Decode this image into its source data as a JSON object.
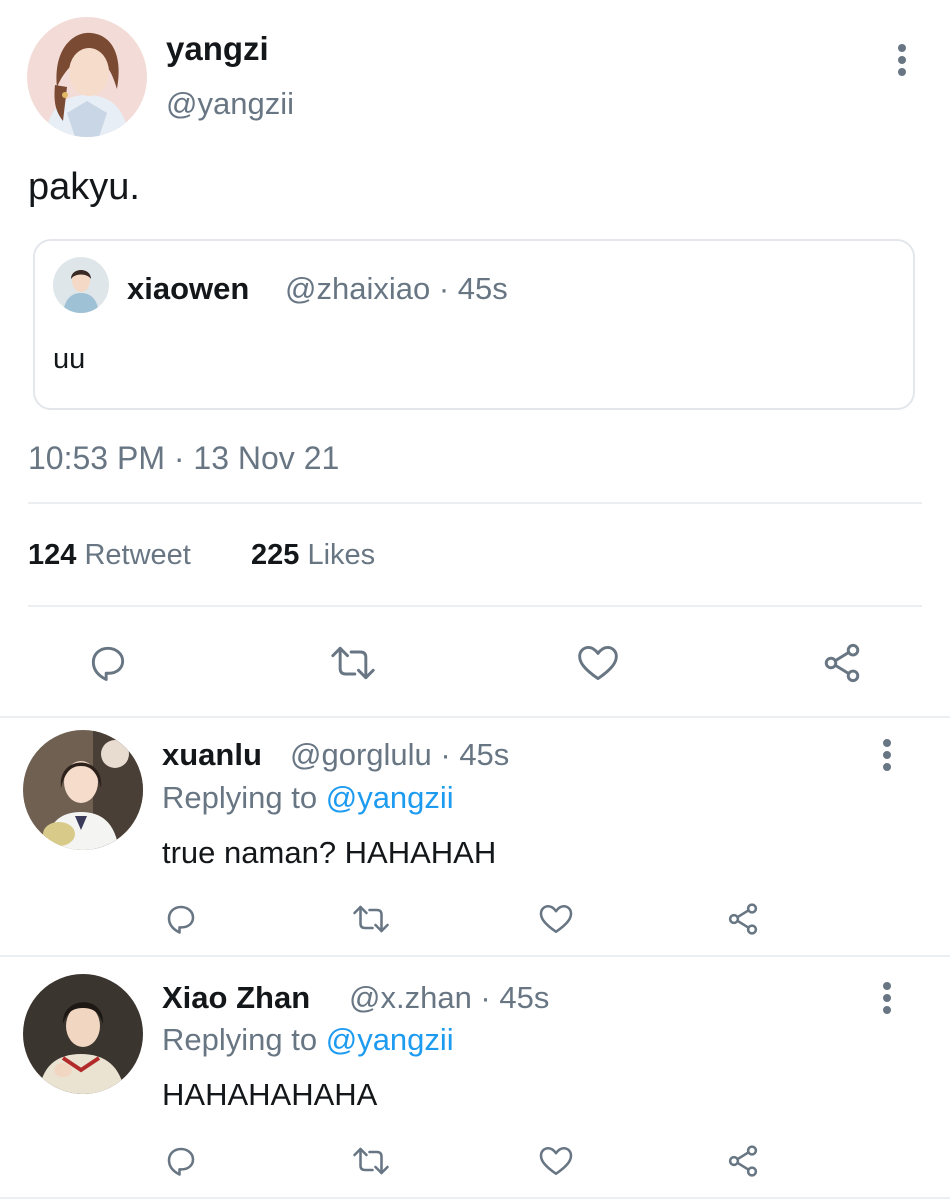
{
  "main_tweet": {
    "display_name": "yangzi",
    "handle": "@yangzii",
    "text": "pakyu.",
    "timestamp": "10:53 PM · 13 Nov 21",
    "quoted": {
      "display_name": "xiaowen",
      "handle_time": "@zhaixiao · 45s",
      "text": "uu"
    },
    "stats": {
      "retweet_count": "124",
      "retweet_label": "Retweet",
      "likes_count": "225",
      "likes_label": "Likes"
    },
    "actions": [
      "reply-icon",
      "retweet-icon",
      "like-icon",
      "share-icon"
    ]
  },
  "replies": [
    {
      "display_name": "xuanlu",
      "handle_time": "@gorglulu · 45s",
      "replying_prefix": "Replying to",
      "replying_to": "@yangzii",
      "text": "true naman? HAHAHAH"
    },
    {
      "display_name": "Xiao Zhan",
      "handle_time": "@x.zhan · 45s",
      "replying_prefix": "Replying to",
      "replying_to": "@yangzii",
      "text": "HAHAHAHAHA"
    }
  ],
  "colors": {
    "text": "#14171a",
    "secondary": "#687684",
    "link": "#1d9bf0",
    "divider": "#eceff1"
  }
}
